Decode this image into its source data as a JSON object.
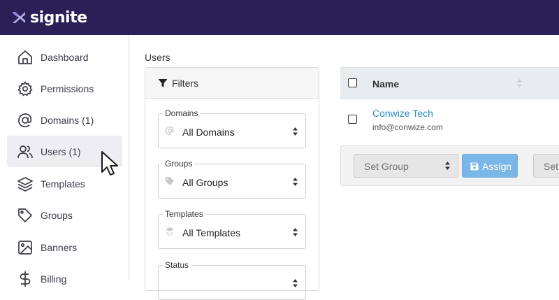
{
  "brand": {
    "name": "signite",
    "color": "#2a1f57"
  },
  "sidebar": {
    "items": [
      {
        "label": "Dashboard",
        "icon": "home-icon"
      },
      {
        "label": "Permissions",
        "icon": "gear-icon"
      },
      {
        "label": "Domains (1)",
        "icon": "at-icon"
      },
      {
        "label": "Users (1)",
        "icon": "users-icon",
        "active": true
      },
      {
        "label": "Templates",
        "icon": "layers-icon"
      },
      {
        "label": "Groups",
        "icon": "tag-icon"
      },
      {
        "label": "Banners",
        "icon": "image-icon"
      },
      {
        "label": "Billing",
        "icon": "dollar-icon"
      }
    ]
  },
  "main": {
    "title": "Users",
    "filters": {
      "title": "Filters",
      "fields": [
        {
          "legend": "Domains",
          "value": "All Domains",
          "icon": "at-icon"
        },
        {
          "legend": "Groups",
          "value": "All Groups",
          "icon": "tag-icon"
        },
        {
          "legend": "Templates",
          "value": "All Templates",
          "icon": "layers-icon"
        },
        {
          "legend": "Status",
          "value": ""
        }
      ]
    },
    "table": {
      "columns": [
        "Name"
      ],
      "rows": [
        {
          "name": "Conwize Tech",
          "email": "info@conwize.com"
        }
      ]
    },
    "actions": {
      "set_group": "Set Group",
      "assign": "Assign",
      "set_other": "Set"
    }
  },
  "colors": {
    "link": "#2d8ac7",
    "assign_button": "#7bb7e6"
  }
}
